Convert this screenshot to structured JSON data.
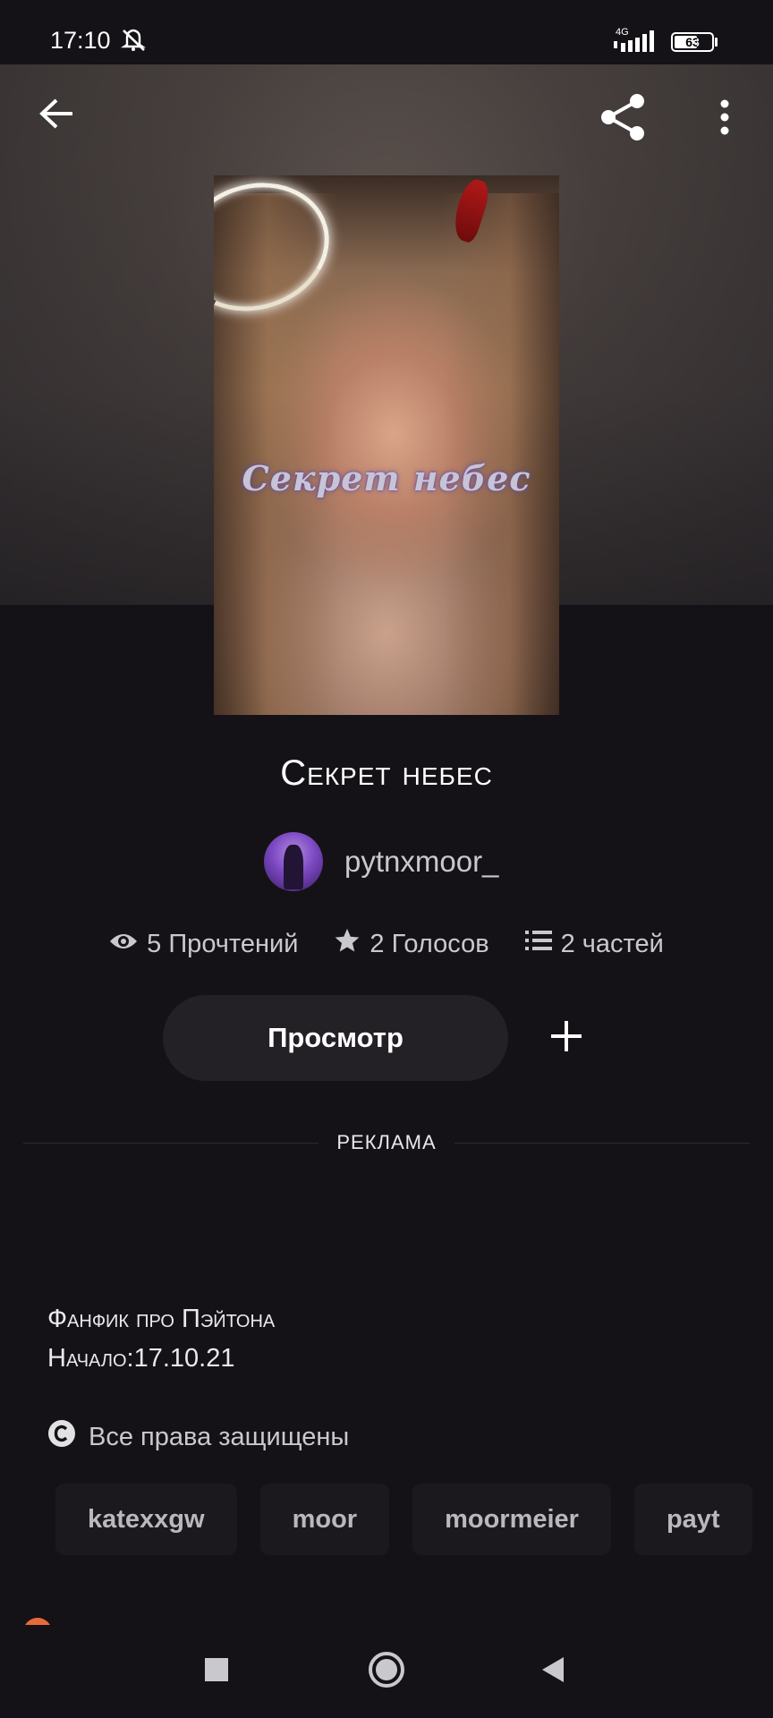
{
  "status_bar": {
    "time": "17:10",
    "network": "4G",
    "battery": "63",
    "battery_level": 0.63
  },
  "toolbar": {
    "back_icon": "arrow-left-icon",
    "share_icon": "share-icon",
    "menu_icon": "more-vertical-icon"
  },
  "story": {
    "cover_title": "Секрет небес",
    "title": "Секрет небес",
    "author": "pytnxmoor_",
    "stats": {
      "reads": "5 Прочтений",
      "votes": "2 Голосов",
      "parts": "2 частей"
    },
    "read_button": "Просмотр",
    "description_line1": "Фанфик про Пэйтона",
    "description_line2": "Начало:17.10.21",
    "rights": "Все права защищены",
    "tags": [
      "katexxgw",
      "moor",
      "moormeier",
      "payt"
    ]
  },
  "ad_label": "РЕКЛАМА",
  "colors": {
    "background": "#141216",
    "button_bg": "#232126",
    "tag_bg": "#1b191d",
    "muted_text": "#c9c9cd"
  }
}
